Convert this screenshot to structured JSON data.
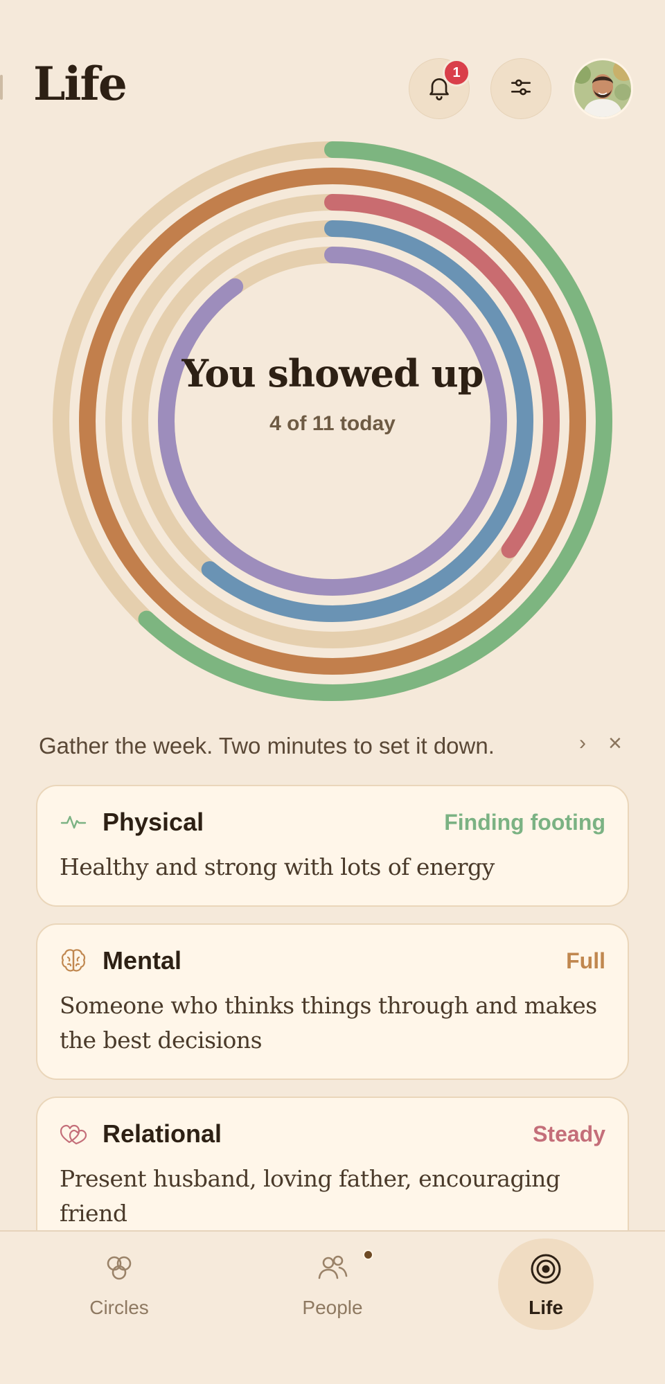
{
  "header": {
    "title": "Life",
    "notifications_count": "1",
    "bell_icon": "bell-icon",
    "filters_icon": "sliders-icon",
    "avatar": "user-avatar"
  },
  "summary": {
    "headline": "You showed up",
    "subline": "4 of 11 today",
    "rings": [
      {
        "color": "#7db580",
        "progress": 0.62
      },
      {
        "color": "#c27f4c",
        "progress": 1.0
      },
      {
        "color": "#c96c70",
        "progress": 0.35
      },
      {
        "color": "#6a93b4",
        "progress": 0.61
      },
      {
        "color": "#9d8dbc",
        "progress": 0.9
      }
    ]
  },
  "prompt": {
    "text": "Gather the week. Two minutes to set it down.",
    "chevron": "›",
    "close": "×"
  },
  "cards": [
    {
      "title": "Physical",
      "status": "Finding footing",
      "status_color": "#7bb283",
      "icon": "pulse-icon",
      "description": "Healthy and strong with lots of energy"
    },
    {
      "title": "Mental",
      "status": "Full",
      "status_color": "#c0874f",
      "icon": "brain-icon",
      "description": "Someone who thinks things through and makes the best decisions"
    },
    {
      "title": "Relational",
      "status": "Steady",
      "status_color": "#c46e79",
      "icon": "hearts-icon",
      "description": "Present husband, loving father, encouraging friend"
    }
  ],
  "nav": {
    "items": [
      {
        "label": "Circles",
        "icon": "circles-icon"
      },
      {
        "label": "People",
        "icon": "people-icon"
      },
      {
        "label": "Life",
        "icon": "target-icon",
        "active": true
      }
    ]
  },
  "colors": {
    "background": "#f5e9da",
    "track": "#e5cfae",
    "text": "#2d2014"
  }
}
